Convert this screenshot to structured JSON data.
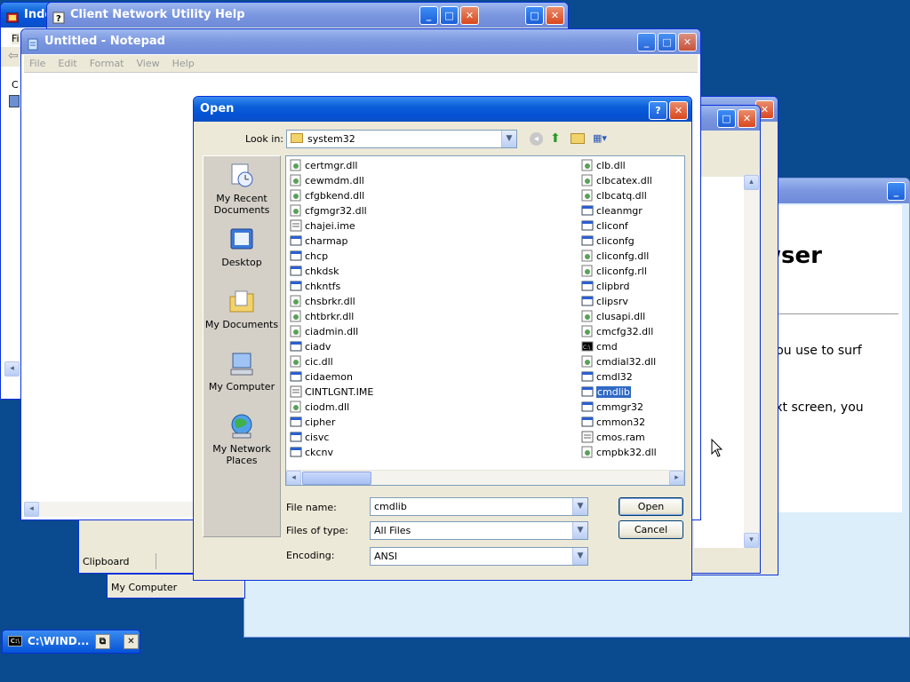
{
  "windows": {
    "inde": {
      "title": "Inde",
      "menu": "Fi",
      "sidebar_letter": "C"
    },
    "help": {
      "title": "Client Network Utility Help"
    },
    "notepad": {
      "title": "Untitled - Notepad",
      "menu": [
        "File",
        "Edit",
        "Format",
        "View",
        "Help"
      ]
    },
    "clipboard": {
      "status": "Clipboard"
    },
    "mycomputer": {
      "status": "My Computer"
    },
    "browser": {
      "heading_fragment": "wser",
      "para1_fragment": "t you use to surf",
      "para2_fragment": "next screen, you"
    },
    "cmd_taskbar": {
      "title": "C:\\WIND..."
    }
  },
  "open_dialog": {
    "title": "Open",
    "help_btn": "?",
    "look_in_label": "Look in:",
    "look_in_value": "system32",
    "places": [
      {
        "label1": "My Recent",
        "label2": "Documents",
        "icon": "recent-icon"
      },
      {
        "label1": "Desktop",
        "label2": "",
        "icon": "desktop-icon"
      },
      {
        "label1": "My Documents",
        "label2": "",
        "icon": "mydocs-icon"
      },
      {
        "label1": "My Computer",
        "label2": "",
        "icon": "mycomputer-icon"
      },
      {
        "label1": "My Network",
        "label2": "Places",
        "icon": "network-icon"
      }
    ],
    "files_left": [
      "certmgr.dll",
      "cewmdm.dll",
      "cfgbkend.dll",
      "cfgmgr32.dll",
      "chajei.ime",
      "charmap",
      "chcp",
      "chkdsk",
      "chkntfs",
      "chsbrkr.dll",
      "chtbrkr.dll",
      "ciadmin.dll",
      "ciadv",
      "cic.dll",
      "cidaemon",
      "CINTLGNT.IME",
      "ciodm.dll",
      "cipher",
      "cisvc",
      "ckcnv"
    ],
    "files_right": [
      "clb.dll",
      "clbcatex.dll",
      "clbcatq.dll",
      "cleanmgr",
      "cliconf",
      "cliconfg",
      "cliconfg.dll",
      "cliconfg.rll",
      "clipbrd",
      "clipsrv",
      "clusapi.dll",
      "cmcfg32.dll",
      "cmd",
      "cmdial32.dll",
      "cmdl32",
      "cmdlib",
      "cmmgr32",
      "cmmon32",
      "cmos.ram",
      "cmpbk32.dll"
    ],
    "selected_file": "cmdlib",
    "file_name_label": "File name:",
    "file_name_value": "cmdlib",
    "files_of_type_label": "Files of type:",
    "files_of_type_value": "All Files",
    "encoding_label": "Encoding:",
    "encoding_value": "ANSI",
    "open_btn": "Open",
    "cancel_btn": "Cancel"
  },
  "colors": {
    "titlebar": "#0553d6",
    "selection": "#316ac5",
    "desktop": "#0a4a8f"
  }
}
